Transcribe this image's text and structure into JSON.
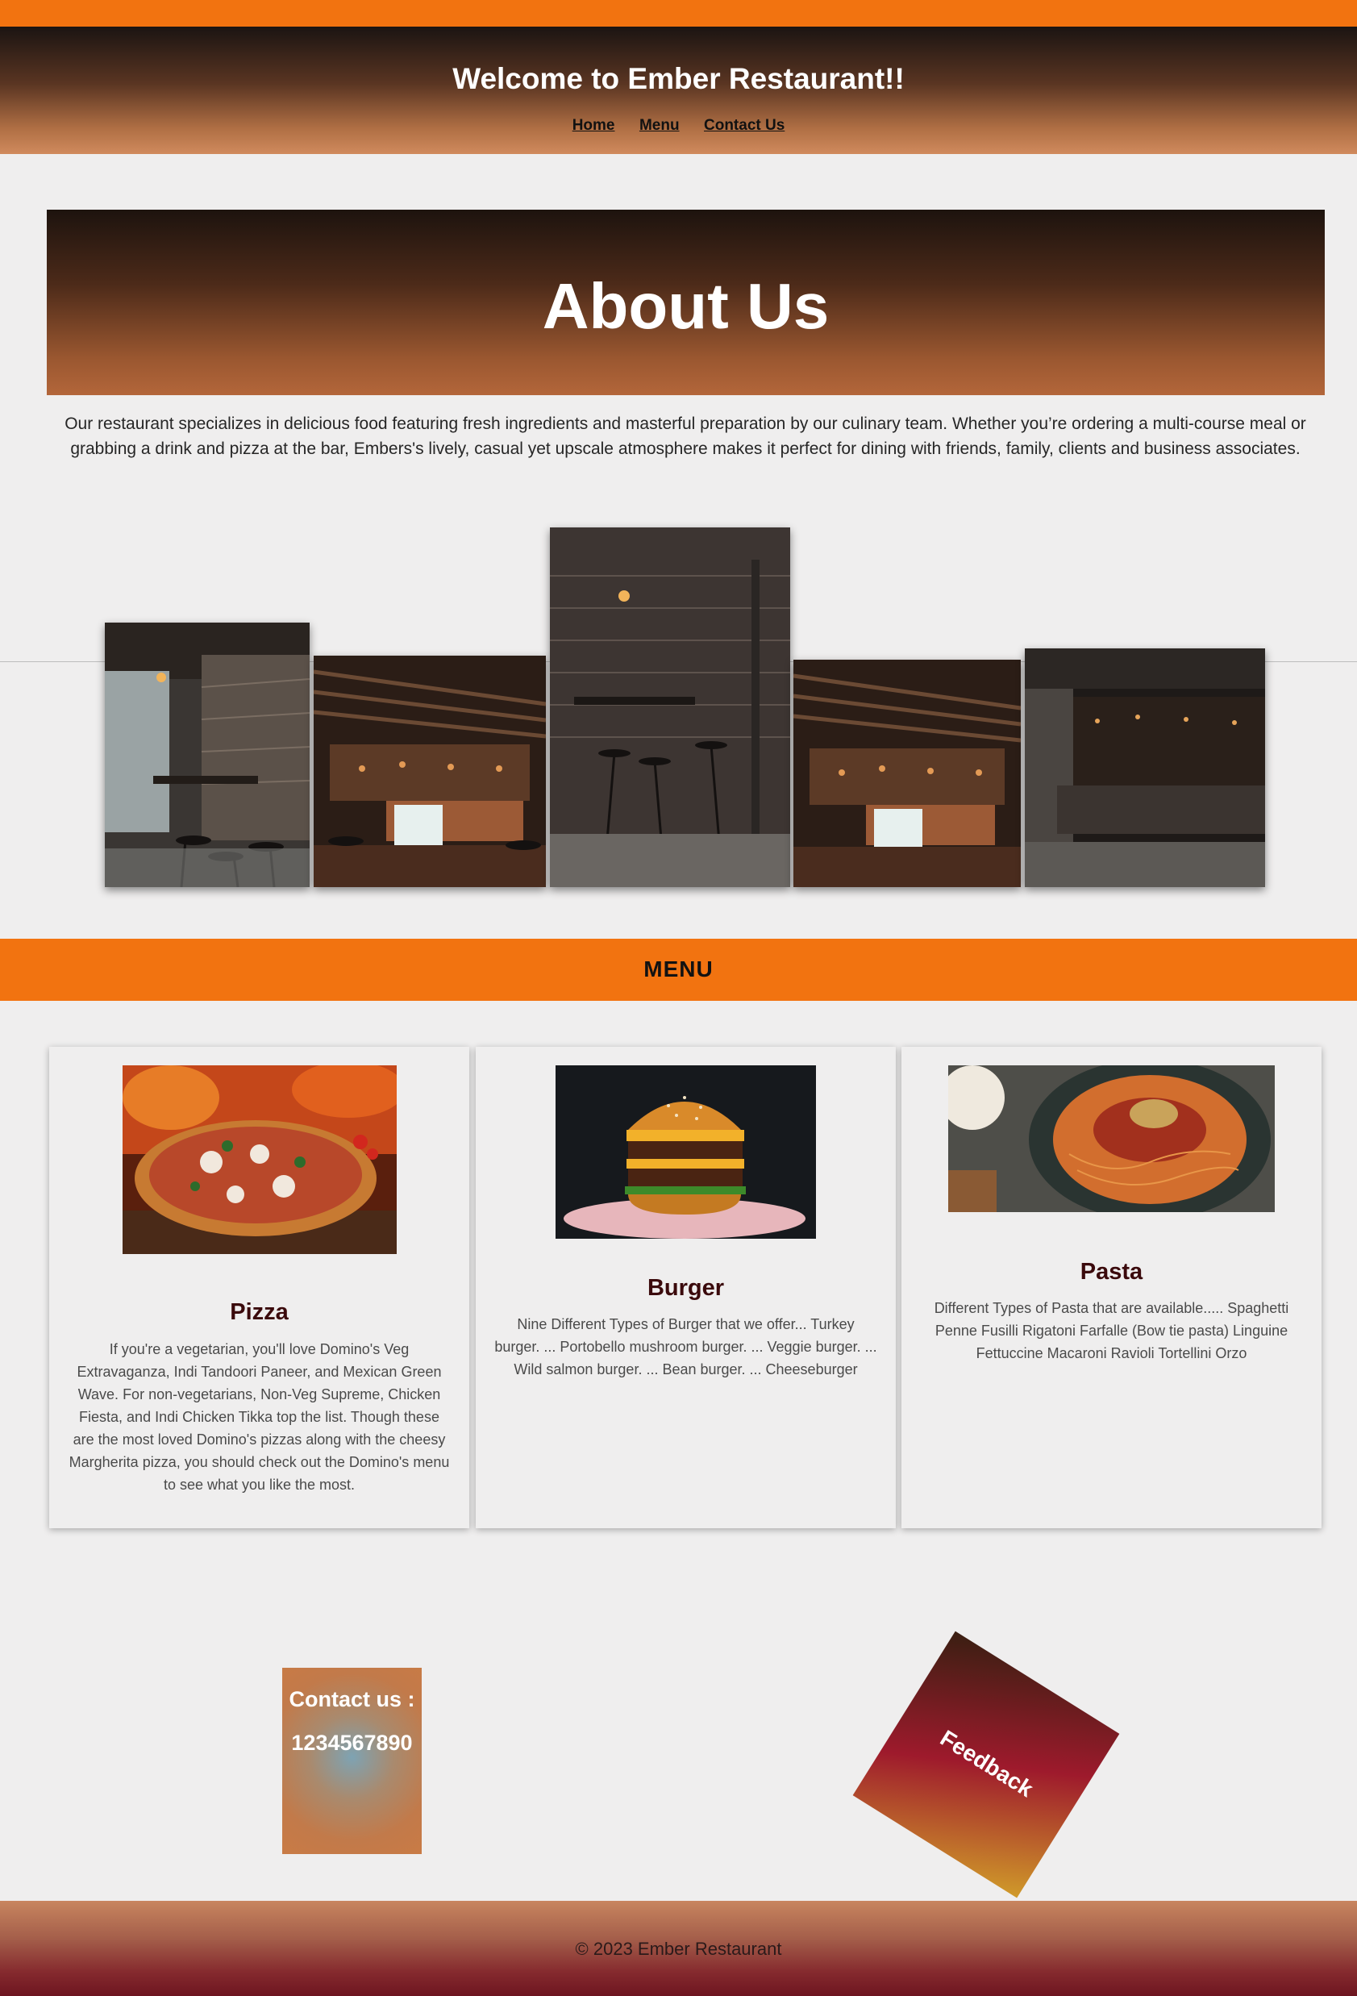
{
  "stray_mark": "\"",
  "colors": {
    "accent_orange": "#f27310",
    "dark_brown": "#1d130e",
    "title_maroon": "#3b0a0c"
  },
  "header": {
    "title": "Welcome to Ember Restaurant!!",
    "nav": [
      "Home",
      "Menu",
      "Contact Us"
    ]
  },
  "about": {
    "heading": "About Us",
    "text": "Our restaurant specializes in delicious food featuring fresh ingredients and masterful preparation by our culinary team. Whether you’re ordering a multi-course meal or grabbing a drink and pizza at the bar, Embers's lively, casual yet upscale atmosphere makes it perfect for dining with friends, family, clients and business associates."
  },
  "gallery": [
    "restaurant-interior-photo",
    "bar-counter-photo",
    "brick-wall-stools-photo",
    "bar-counter-photo",
    "dark-bar-photo"
  ],
  "menu": {
    "heading": "MENU",
    "items": [
      {
        "name": "Pizza",
        "image": "pizza-photo",
        "description": "If you're a vegetarian, you'll love Domino's Veg Extravaganza, Indi Tandoori Paneer, and Mexican Green Wave. For non-vegetarians, Non-Veg Supreme, Chicken Fiesta, and Indi Chicken Tikka top the list. Though these are the most loved Domino's pizzas along with the cheesy Margherita pizza, you should check out the Domino's menu to see what you like the most."
      },
      {
        "name": "Burger",
        "image": "burger-photo",
        "description": "Nine Different Types of Burger that we offer... Turkey burger. ... Portobello mushroom burger. ... Veggie burger. ... Wild salmon burger. ... Bean burger. ... Cheeseburger"
      },
      {
        "name": "Pasta",
        "image": "pasta-photo",
        "description": "Different Types of Pasta that are available..... Spaghetti Penne Fusilli Rigatoni Farfalle (Bow tie pasta) Linguine Fettuccine Macaroni Ravioli Tortellini Orzo"
      }
    ]
  },
  "contact": {
    "label": "Contact us :",
    "phone": "1234567890"
  },
  "feedback": {
    "label": "Feedback"
  },
  "footer": {
    "text": "© 2023 Ember Restaurant"
  }
}
